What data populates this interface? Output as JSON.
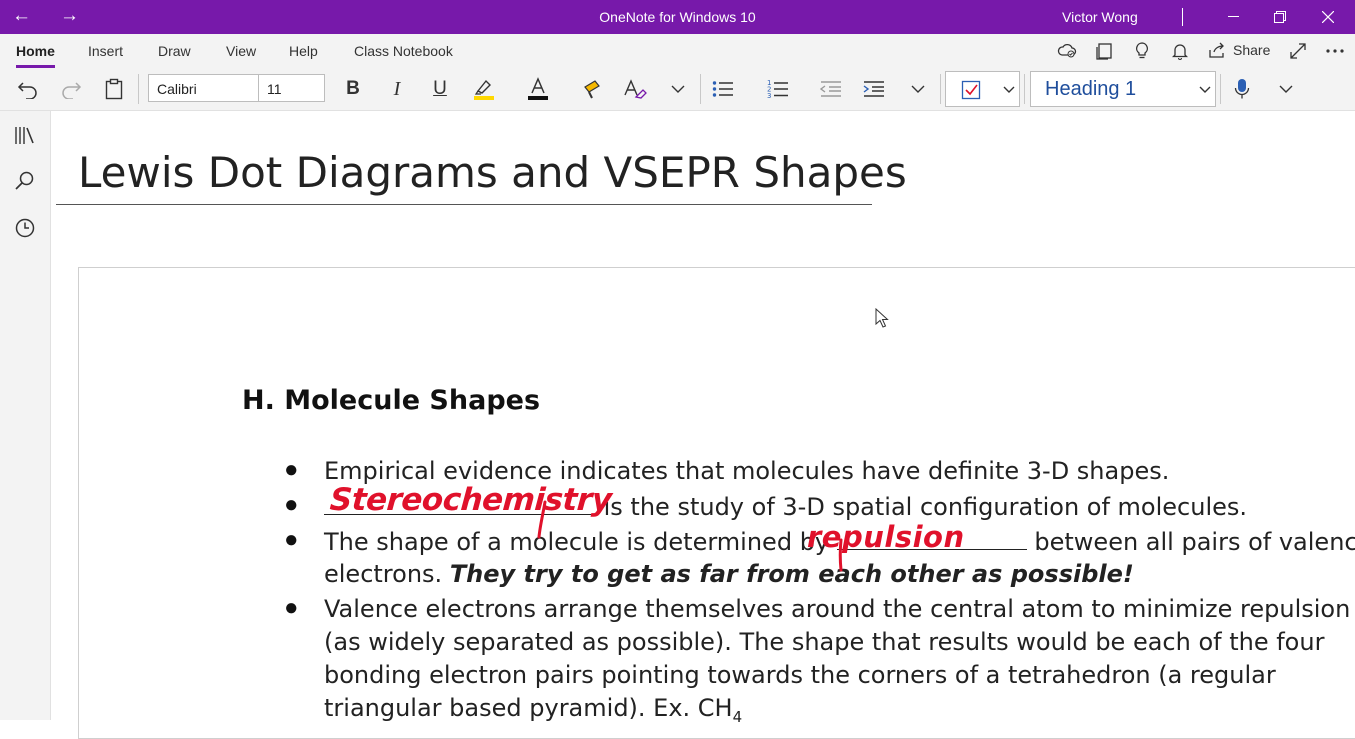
{
  "window": {
    "app_title": "OneNote for Windows 10",
    "user_name": "Victor Wong",
    "accent_color": "#7719aa"
  },
  "ribbon": {
    "tabs": [
      "Home",
      "Insert",
      "Draw",
      "View",
      "Help",
      "Class Notebook"
    ],
    "active_tab": "Home",
    "share_label": "Share"
  },
  "toolbar": {
    "font_name": "Calibri",
    "font_size": "11",
    "style": "Heading 1",
    "highlight_color": "#ffd800",
    "font_color": "#111111"
  },
  "page": {
    "title": "Lewis Dot Diagrams and VSEPR Shapes",
    "heading": "H. Molecule Shapes",
    "bullet_1": "Empirical evidence indicates that molecules have definite 3-D shapes.",
    "bullet_2_rest": " is the study of 3-D spatial configuration of molecules.",
    "bullet_3_start": "The shape of a molecule is determined by ",
    "bullet_3_end": " between all pairs of valence",
    "bullet_3_line2": "electrons.  ",
    "bullet_3_emphasis": "They try to get as far from each other as possible!",
    "bullet_4_line1": "Valence electrons arrange themselves around the central atom to minimize repulsion",
    "bullet_4_line2": "(as widely separated as possible). The shape that results would be each of the four",
    "bullet_4_line3": "bonding electron pairs pointing towards the corners of a tetrahedron (a regular",
    "bullet_4_line4": "triangular based pyramid). Ex. CH",
    "bullet_4_subscript": "4",
    "ink_1": "Stereochemistry",
    "ink_2": "repulsion",
    "ink_color": "#e0112b"
  }
}
